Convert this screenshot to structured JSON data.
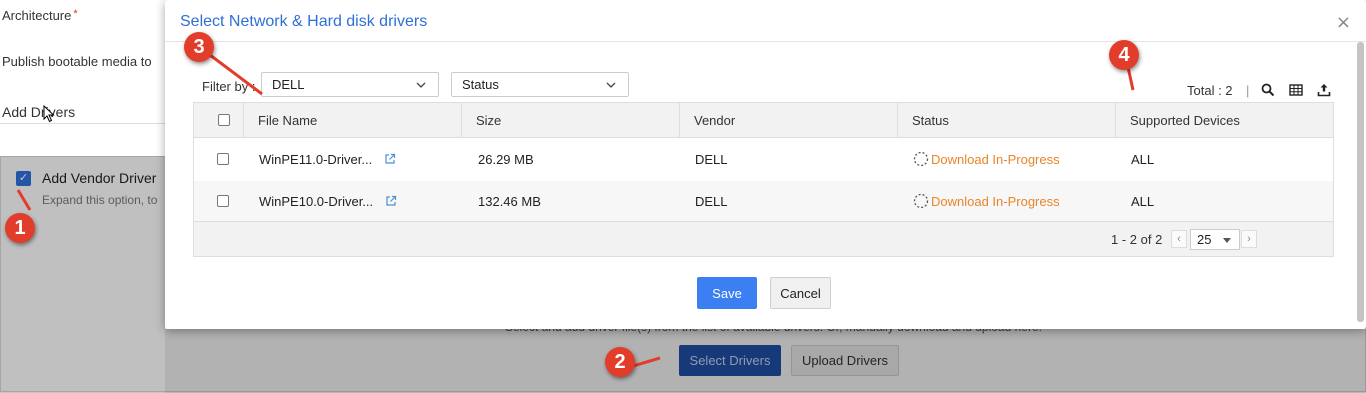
{
  "background": {
    "architecture_label": "Architecture",
    "required_mark": "*",
    "publish_label": "Publish bootable media to",
    "add_drivers_label": "Add Drivers",
    "vendor_title": "Add Vendor Driver",
    "vendor_desc": "Expand this option, to",
    "bottom_hint": "Select and add driver file(s) from the list of available drivers. Or, manually download and upload here.",
    "select_drivers_label": "Select Drivers",
    "upload_drivers_label": "Upload Drivers"
  },
  "modal": {
    "title": "Select Network & Hard disk drivers",
    "close_glyph": "×",
    "filter_label": "Filter by :",
    "vendor_filter_value": "DELL",
    "status_filter_value": "Status",
    "total_label": "Total : 2",
    "toolbar_separator": "|",
    "columns": [
      "File Name",
      "Size",
      "Vendor",
      "Status",
      "Supported Devices"
    ],
    "rows": [
      {
        "file_name": "WinPE11.0-Driver...",
        "size": "26.29 MB",
        "vendor": "DELL",
        "status": "Download In-Progress",
        "supported": "ALL"
      },
      {
        "file_name": "WinPE10.0-Driver...",
        "size": "132.46 MB",
        "vendor": "DELL",
        "status": "Download In-Progress",
        "supported": "ALL"
      }
    ],
    "pager_text": "1 - 2 of 2",
    "page_size": "25",
    "save_label": "Save",
    "cancel_label": "Cancel"
  },
  "markers": [
    "1",
    "2",
    "3",
    "4"
  ],
  "colors": {
    "accent": "#2f6fd8",
    "save_button": "#3b7ff2",
    "status_orange": "#e8862a",
    "marker_red": "#e23d2a"
  },
  "icons": [
    "checkbox-checked-icon",
    "close-icon",
    "chevron-down-icon",
    "search-icon",
    "column-grid-icon",
    "export-icon",
    "external-link-icon",
    "spinner-icon",
    "chevron-left-icon",
    "chevron-right-icon",
    "cursor-icon"
  ]
}
